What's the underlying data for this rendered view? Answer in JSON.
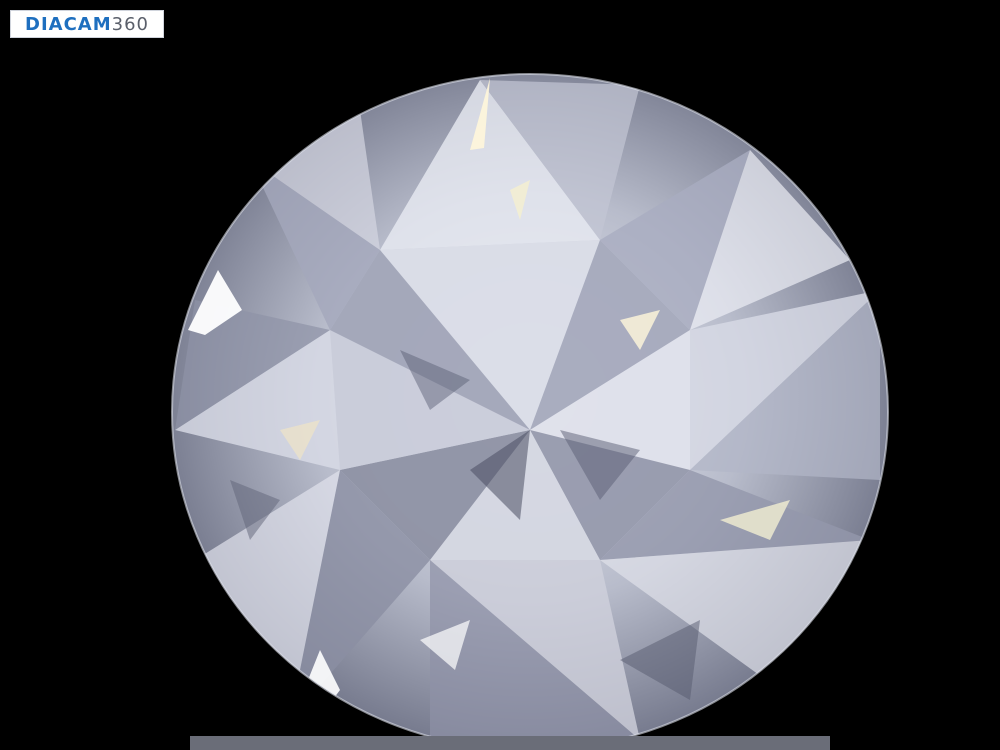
{
  "logo": {
    "brand": "DIACAM",
    "number": "360"
  },
  "colors": {
    "background": "#000000",
    "logo_blue": "#1e6fbf",
    "logo_gray": "#5a5f6a"
  },
  "image": {
    "subject": "round-brilliant-diamond"
  }
}
